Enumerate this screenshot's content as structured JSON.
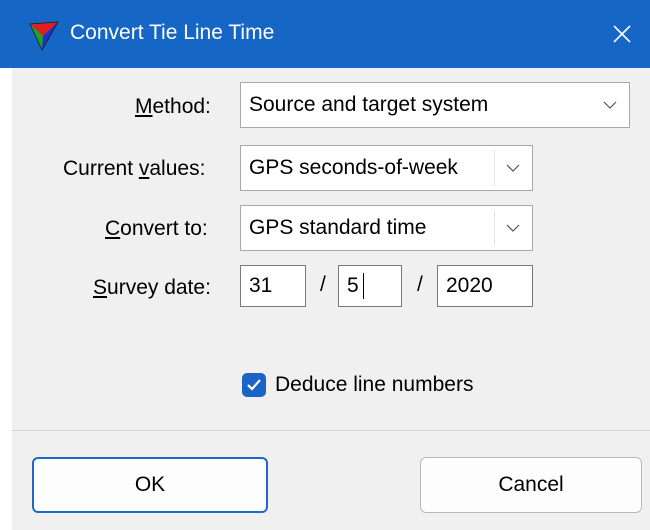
{
  "window": {
    "title": "Convert Tie Line Time",
    "close_icon": "close-icon",
    "app_icon": "tri-color-arrow-icon"
  },
  "form": {
    "method": {
      "label_prefix": "",
      "label_mnemonic": "M",
      "label_rest": "ethod:",
      "value": "Source and target system"
    },
    "current_values": {
      "label_prefix": "Current ",
      "label_mnemonic": "v",
      "label_rest": "alues:",
      "value": "GPS seconds-of-week"
    },
    "convert_to": {
      "label_prefix": "",
      "label_mnemonic": "C",
      "label_rest": "onvert to:",
      "value": "GPS standard time"
    },
    "survey_date": {
      "label_prefix": "",
      "label_mnemonic": "S",
      "label_rest": "urvey date:",
      "day": "31",
      "month": "5",
      "year": "2020",
      "separator": "/"
    },
    "deduce_line_numbers": {
      "label": "Deduce line numbers",
      "checked": true
    }
  },
  "buttons": {
    "ok": "OK",
    "cancel": "Cancel"
  },
  "colors": {
    "titlebar": "#1566c5",
    "accent": "#1a64c6",
    "dialog_bg": "#f0f0f0"
  }
}
